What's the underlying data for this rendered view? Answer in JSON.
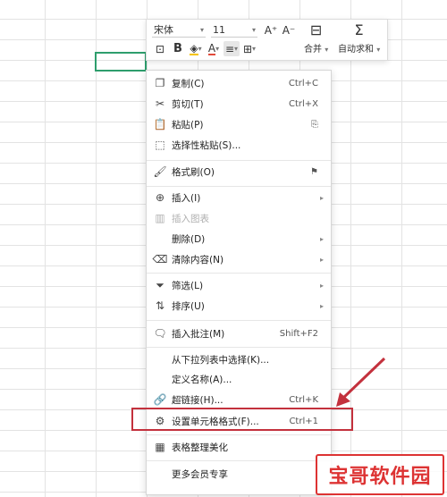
{
  "toolbar": {
    "font_name": "宋体",
    "font_size": "11",
    "grow_font_icon": "A⁺",
    "shrink_font_icon": "A⁻",
    "merge_label": "合并",
    "autosum_label": "自动求和",
    "bold_label": "B"
  },
  "menu": {
    "items": [
      {
        "label": "复制(C)",
        "shortcut": "Ctrl+C",
        "icon": "copy-icon"
      },
      {
        "label": "剪切(T)",
        "shortcut": "Ctrl+X",
        "icon": "cut-icon"
      },
      {
        "label": "粘贴(P)",
        "shortcut": "",
        "icon": "paste-icon"
      },
      {
        "label": "选择性粘贴(S)...",
        "shortcut": "",
        "icon": "paste-special-icon"
      },
      {
        "label": "格式刷(O)",
        "shortcut": "",
        "icon": "format-painter-icon"
      },
      {
        "label": "插入(I)",
        "shortcut": "",
        "icon": "insert-icon"
      },
      {
        "label": "插入图表",
        "shortcut": "",
        "icon": "chart-icon"
      },
      {
        "label": "删除(D)",
        "shortcut": "",
        "icon": ""
      },
      {
        "label": "清除内容(N)",
        "shortcut": "",
        "icon": "eraser-icon"
      },
      {
        "label": "筛选(L)",
        "shortcut": "",
        "icon": "filter-icon"
      },
      {
        "label": "排序(U)",
        "shortcut": "",
        "icon": "sort-icon"
      },
      {
        "label": "插入批注(M)",
        "shortcut": "Shift+F2",
        "icon": "comment-icon"
      },
      {
        "label": "从下拉列表中选择(K)...",
        "shortcut": "",
        "icon": ""
      },
      {
        "label": "定义名称(A)...",
        "shortcut": "",
        "icon": ""
      },
      {
        "label": "超链接(H)...",
        "shortcut": "Ctrl+K",
        "icon": "link-icon"
      },
      {
        "label": "设置单元格格式(F)...",
        "shortcut": "Ctrl+1",
        "icon": "format-cells-icon"
      },
      {
        "label": "表格整理美化",
        "shortcut": "",
        "icon": "table-beautify-icon"
      },
      {
        "label": "更多会员专享",
        "shortcut": "",
        "icon": ""
      }
    ]
  },
  "watermark": {
    "text": "宝哥软件园"
  },
  "colors": {
    "highlight": "#c3313d",
    "selection": "#2e9e6d"
  }
}
